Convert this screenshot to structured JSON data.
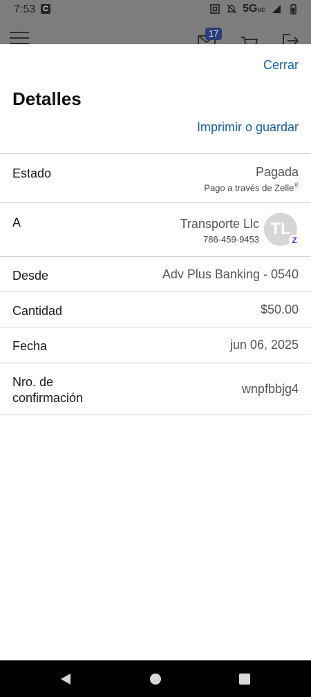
{
  "status_bar": {
    "time": "7:53",
    "app_badge": "C",
    "network": "5G",
    "network_sub": "UC"
  },
  "app_toolbar": {
    "mail_badge_count": "17",
    "icons": [
      "menu-icon",
      "mail-icon",
      "cart-icon",
      "exit-icon"
    ]
  },
  "sheet": {
    "close_label": "Cerrar",
    "title": "Detalles",
    "print_label": "Imprimir o guardar"
  },
  "details": {
    "estado": {
      "label": "Estado",
      "value": "Pagada",
      "sub": "Pago a través de Zelle",
      "sub_mark": "®"
    },
    "a": {
      "label": "A",
      "value": "Transporte Llc",
      "phone": "786-459-9453",
      "initials": "TL",
      "badge": "Z"
    },
    "desde": {
      "label": "Desde",
      "value": "Adv Plus Banking - 0540"
    },
    "cantidad": {
      "label": "Cantidad",
      "value": "$50.00"
    },
    "fecha": {
      "label": "Fecha",
      "value": "jun 06, 2025"
    },
    "confirmacion": {
      "label_line1": "Nro. de",
      "label_line2": "confirmación",
      "value": "wnpfbbjg4"
    }
  },
  "colors": {
    "link": "#145ea8",
    "zelle": "#6d1ed4",
    "dim_overlay": "#7d7d7d",
    "badge_bg": "#2a3e78"
  }
}
